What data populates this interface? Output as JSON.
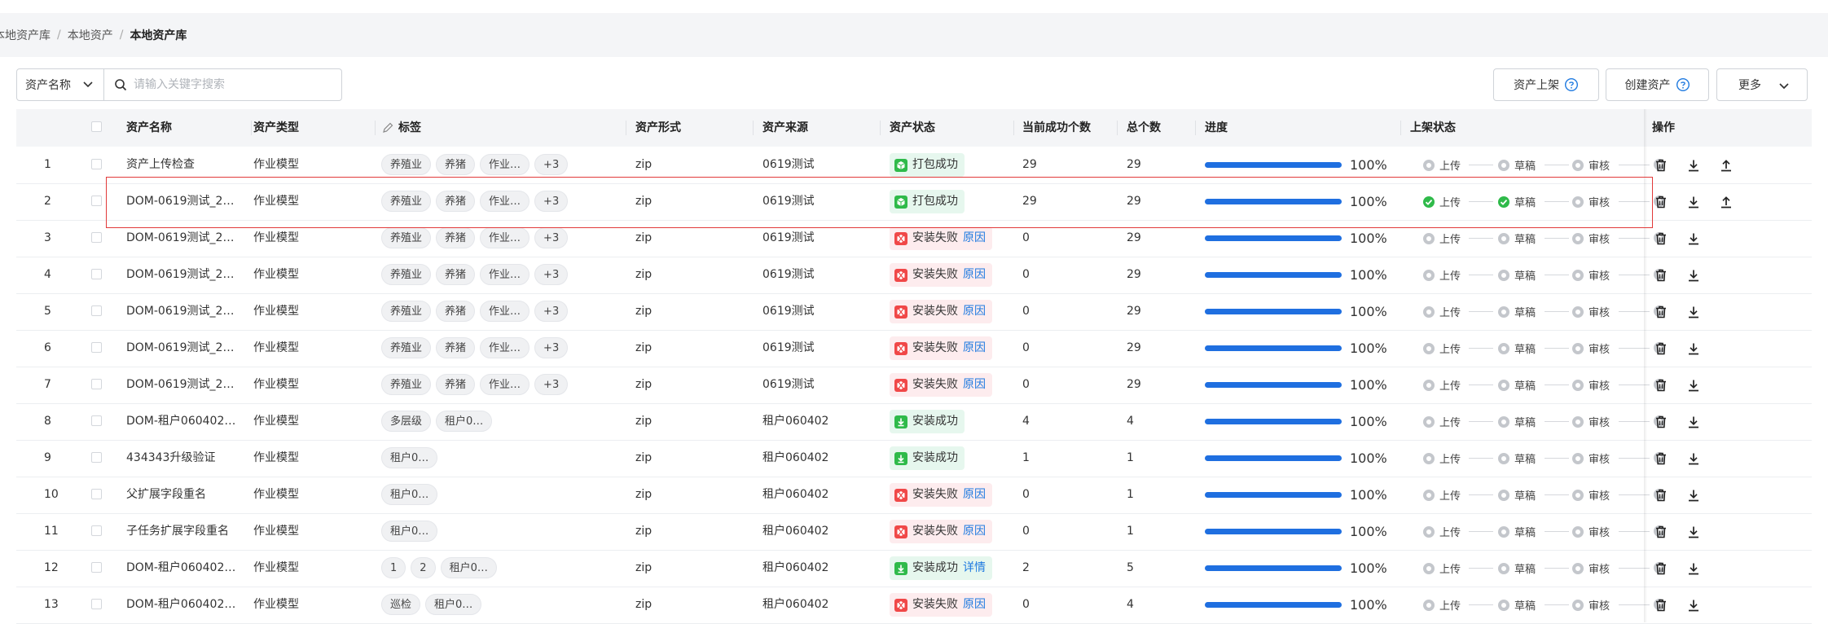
{
  "breadcrumb": {
    "items": [
      "本地资产库",
      "本地资产",
      "本地资产库"
    ]
  },
  "toolbar": {
    "field_select": "资产名称",
    "search_placeholder": "请输入关键字搜索",
    "publish_label": "资产上架",
    "create_label": "创建资产",
    "more_label": "更多"
  },
  "table": {
    "headers": {
      "name": "资产名称",
      "type": "资产类型",
      "tags": "标签",
      "form": "资产形式",
      "source": "资产来源",
      "status": "资产状态",
      "success": "当前成功个数",
      "total": "总个数",
      "progress": "进度",
      "publish": "上架状态",
      "ops": "操作"
    },
    "publish_steps": [
      "上传",
      "草稿",
      "审核"
    ],
    "rows": [
      {
        "no": "1",
        "name": "资产上传检查",
        "type": "作业模型",
        "tags": [
          "养殖业",
          "养猪",
          "作业…",
          "+3"
        ],
        "form": "zip",
        "source": "0619测试",
        "status": "打包成功",
        "status_kind": "green-box",
        "link": "",
        "success": "29",
        "total": "29",
        "progress": "100%",
        "steps_done": 0,
        "upload": true
      },
      {
        "no": "2",
        "name": "DOM-0619测试_2…",
        "type": "作业模型",
        "tags": [
          "养殖业",
          "养猪",
          "作业…",
          "+3"
        ],
        "form": "zip",
        "source": "0619测试",
        "status": "打包成功",
        "status_kind": "green-box",
        "link": "",
        "success": "29",
        "total": "29",
        "progress": "100%",
        "steps_done": 2,
        "upload": true
      },
      {
        "no": "3",
        "name": "DOM-0619测试_2…",
        "type": "作业模型",
        "tags": [
          "养殖业",
          "养猪",
          "作业…",
          "+3"
        ],
        "form": "zip",
        "source": "0619测试",
        "status": "安装失败",
        "status_kind": "red",
        "link": "原因",
        "success": "0",
        "total": "29",
        "progress": "100%",
        "steps_done": 0,
        "upload": false
      },
      {
        "no": "4",
        "name": "DOM-0619测试_2…",
        "type": "作业模型",
        "tags": [
          "养殖业",
          "养猪",
          "作业…",
          "+3"
        ],
        "form": "zip",
        "source": "0619测试",
        "status": "安装失败",
        "status_kind": "red",
        "link": "原因",
        "success": "0",
        "total": "29",
        "progress": "100%",
        "steps_done": 0,
        "upload": false
      },
      {
        "no": "5",
        "name": "DOM-0619测试_2…",
        "type": "作业模型",
        "tags": [
          "养殖业",
          "养猪",
          "作业…",
          "+3"
        ],
        "form": "zip",
        "source": "0619测试",
        "status": "安装失败",
        "status_kind": "red",
        "link": "原因",
        "success": "0",
        "total": "29",
        "progress": "100%",
        "steps_done": 0,
        "upload": false
      },
      {
        "no": "6",
        "name": "DOM-0619测试_2…",
        "type": "作业模型",
        "tags": [
          "养殖业",
          "养猪",
          "作业…",
          "+3"
        ],
        "form": "zip",
        "source": "0619测试",
        "status": "安装失败",
        "status_kind": "red",
        "link": "原因",
        "success": "0",
        "total": "29",
        "progress": "100%",
        "steps_done": 0,
        "upload": false
      },
      {
        "no": "7",
        "name": "DOM-0619测试_2…",
        "type": "作业模型",
        "tags": [
          "养殖业",
          "养猪",
          "作业…",
          "+3"
        ],
        "form": "zip",
        "source": "0619测试",
        "status": "安装失败",
        "status_kind": "red",
        "link": "原因",
        "success": "0",
        "total": "29",
        "progress": "100%",
        "steps_done": 0,
        "upload": false
      },
      {
        "no": "8",
        "name": "DOM-租户060402…",
        "type": "作业模型",
        "tags": [
          "多层级",
          "租户0…"
        ],
        "form": "zip",
        "source": "租户060402",
        "status": "安装成功",
        "status_kind": "green-dl",
        "link": "",
        "success": "4",
        "total": "4",
        "progress": "100%",
        "steps_done": 0,
        "upload": false
      },
      {
        "no": "9",
        "name": "434343升级验证",
        "type": "作业模型",
        "tags": [
          "租户0…"
        ],
        "form": "zip",
        "source": "租户060402",
        "status": "安装成功",
        "status_kind": "green-dl",
        "link": "",
        "success": "1",
        "total": "1",
        "progress": "100%",
        "steps_done": 0,
        "upload": false
      },
      {
        "no": "10",
        "name": "父扩展字段重名",
        "type": "作业模型",
        "tags": [
          "租户0…"
        ],
        "form": "zip",
        "source": "租户060402",
        "status": "安装失败",
        "status_kind": "red",
        "link": "原因",
        "success": "0",
        "total": "1",
        "progress": "100%",
        "steps_done": 0,
        "upload": false
      },
      {
        "no": "11",
        "name": "子任务扩展字段重名",
        "type": "作业模型",
        "tags": [
          "租户0…"
        ],
        "form": "zip",
        "source": "租户060402",
        "status": "安装失败",
        "status_kind": "red",
        "link": "原因",
        "success": "0",
        "total": "1",
        "progress": "100%",
        "steps_done": 0,
        "upload": false
      },
      {
        "no": "12",
        "name": "DOM-租户060402…",
        "type": "作业模型",
        "tags": [
          "1",
          "2",
          "租户0…"
        ],
        "form": "zip",
        "source": "租户060402",
        "status": "安装成功",
        "status_kind": "green-dl",
        "link": "详情",
        "success": "2",
        "total": "5",
        "progress": "100%",
        "steps_done": 0,
        "upload": false
      },
      {
        "no": "13",
        "name": "DOM-租户060402…",
        "type": "作业模型",
        "tags": [
          "巡检",
          "租户0…"
        ],
        "form": "zip",
        "source": "租户060402",
        "status": "安装失败",
        "status_kind": "red",
        "link": "原因",
        "success": "0",
        "total": "4",
        "progress": "100%",
        "steps_done": 0,
        "upload": false
      }
    ]
  },
  "colors": {
    "accent": "#1f6fe0",
    "success": "#2fba4a",
    "danger": "#e23a3a",
    "link": "#1f7ae0"
  }
}
